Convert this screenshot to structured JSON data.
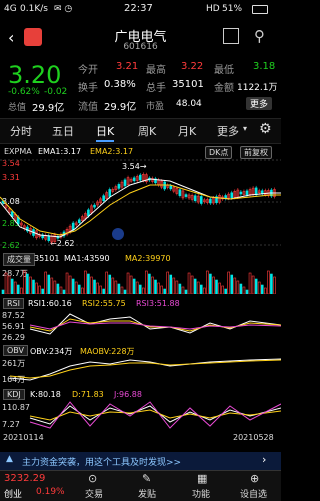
{
  "status": {
    "left": "4G",
    "net": "0.1K/s",
    "time": "22:37",
    "right": "HD",
    "battery": "51%"
  },
  "header": {
    "title": "广电电气",
    "code": "601616"
  },
  "quote": {
    "price": "3.20",
    "change_pct": "-0.62%",
    "change": "-0.02",
    "open_label": "今开",
    "open": "3.21",
    "high_label": "最高",
    "high": "3.22",
    "low_label": "最低",
    "low": "3.18",
    "turnover_label": "换手",
    "turnover": "0.38%",
    "volume_label": "总手",
    "volume": "35101",
    "amount_label": "金额",
    "amount": "1122.1万",
    "mcap_label": "总值",
    "mcap": "29.9亿",
    "float_label": "流值",
    "float": "29.9亿",
    "pe_label": "市盈",
    "pe": "48.04",
    "more_label": "更多"
  },
  "tabs": {
    "items": [
      "分时",
      "五日",
      "日K",
      "周K",
      "月K",
      "更多"
    ],
    "active": "日K"
  },
  "main_chart": {
    "ema_title": "EXPMA",
    "ema1": "EMA1:3.17",
    "ema2": "EMA2:3.17",
    "dk_btn": "DK点",
    "fq_btn": "前复权",
    "y_top": "3.54",
    "y_mid1": "3.31",
    "y_mid2": "3.08",
    "y_mid3": "2.85",
    "y_bot": "2.62",
    "high_note": "3.54→",
    "low_note": "←2.62"
  },
  "volume": {
    "btn": "成交量",
    "vol": "35101",
    "ma1": "MA1:43590",
    "ma2": "MA2:39970",
    "y": "28.7万"
  },
  "rsi": {
    "btn": "RSI",
    "r1": "RSI1:60.16",
    "r2": "RSI2:55.75",
    "r3": "RSI3:51.88",
    "y1": "87.52",
    "y2": "56.91",
    "y3": "26.29"
  },
  "obv": {
    "btn": "OBV",
    "obv": "OBV:234万",
    "maobv": "MAOBV:228万",
    "y1": "261万",
    "y2": "164万"
  },
  "kdj": {
    "btn": "KDJ",
    "k": "K:80.18",
    "d": "D:71.83",
    "j": "J:96.88",
    "y1": "110.87",
    "y2": "7.27"
  },
  "dates": {
    "start": "20210114",
    "end": "20210528"
  },
  "news": {
    "text": "主力资金突袭，用这个工具及时发现>>"
  },
  "index": {
    "value": "3232.29",
    "change": "0.19%",
    "name": "创业"
  },
  "nav": {
    "items": [
      "交易",
      "发贴",
      "功能",
      "设自选"
    ]
  },
  "chart_data": {
    "type": "candlestick",
    "ylim": [
      2.62,
      3.54
    ]
  }
}
